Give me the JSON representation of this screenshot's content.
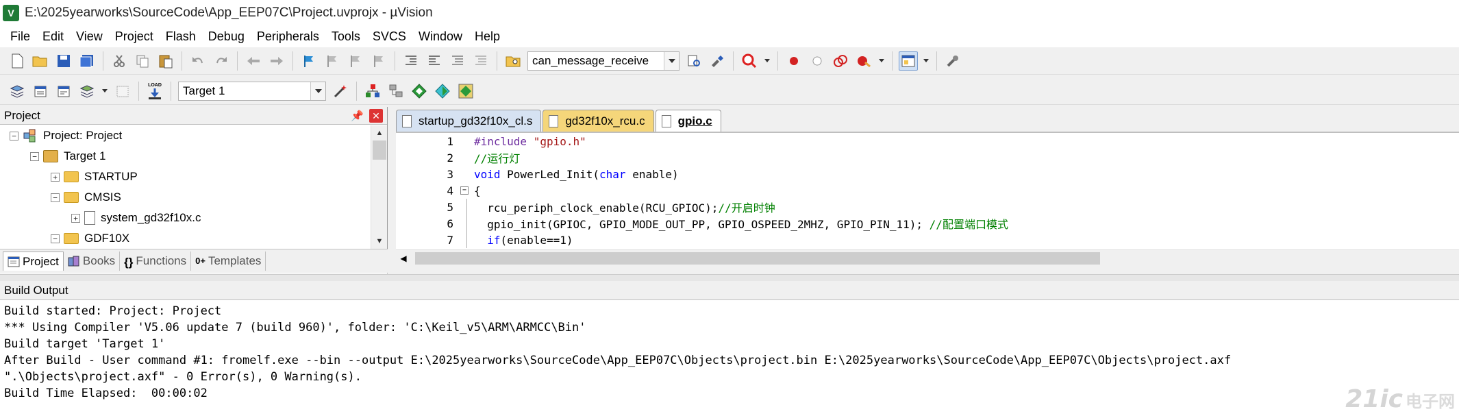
{
  "window": {
    "title": "E:\\2025yearworks\\SourceCode\\App_EEP07C\\Project.uvprojx - µVision",
    "app_icon": "V"
  },
  "menu": [
    "File",
    "Edit",
    "View",
    "Project",
    "Flash",
    "Debug",
    "Peripherals",
    "Tools",
    "SVCS",
    "Window",
    "Help"
  ],
  "toolbar1": {
    "find_combo_value": "can_message_receive"
  },
  "toolbar2": {
    "target_combo_value": "Target 1",
    "load_label": "LOAD"
  },
  "project_panel": {
    "title": "Project",
    "pin_glyph": "📌",
    "close_glyph": "✕",
    "tree": [
      {
        "label": "Project: Project",
        "toggle": "−"
      },
      {
        "label": "Target 1",
        "toggle": "−"
      },
      {
        "label": "STARTUP",
        "toggle": "+"
      },
      {
        "label": "CMSIS",
        "toggle": "−"
      },
      {
        "label": "system_gd32f10x.c",
        "toggle": "+"
      },
      {
        "label": "GDF10X",
        "toggle": "−"
      }
    ],
    "tabs": [
      "Project",
      "Books",
      "Functions",
      "Templates"
    ],
    "tab_glyphs": [
      "{}",
      "0+"
    ]
  },
  "editor": {
    "tabs": [
      "startup_gd32f10x_cl.s",
      "gd32f10x_rcu.c",
      "gpio.c"
    ],
    "lines": [
      {
        "n": "1",
        "parts": [
          [
            "pp",
            "#include "
          ],
          [
            "str",
            "\"gpio.h\""
          ]
        ]
      },
      {
        "n": "2",
        "parts": [
          [
            "cm",
            "//运行灯"
          ]
        ]
      },
      {
        "n": "3",
        "parts": [
          [
            "kw",
            "void"
          ],
          [
            "",
            " PowerLed_Init("
          ],
          [
            "kw",
            "char"
          ],
          [
            "",
            " enable)"
          ]
        ]
      },
      {
        "n": "4",
        "parts": [
          [
            "",
            "{"
          ]
        ]
      },
      {
        "n": "5",
        "parts": [
          [
            "",
            "  rcu_periph_clock_enable(RCU_GPIOC);"
          ],
          [
            "cm",
            "//开启时钟"
          ]
        ]
      },
      {
        "n": "6",
        "parts": [
          [
            "",
            "  gpio_init(GPIOC, GPIO_MODE_OUT_PP, GPIO_OSPEED_2MHZ, GPIO_PIN_11); "
          ],
          [
            "cm",
            "//配置端口模式"
          ]
        ]
      },
      {
        "n": "7",
        "parts": [
          [
            "",
            "  "
          ],
          [
            "kw",
            "if"
          ],
          [
            "",
            "(enable==1)"
          ]
        ]
      }
    ]
  },
  "build": {
    "title": "Build Output",
    "lines": [
      "Build started: Project: Project",
      "*** Using Compiler 'V5.06 update 7 (build 960)', folder: 'C:\\Keil_v5\\ARM\\ARMCC\\Bin'",
      "Build target 'Target 1'",
      "After Build - User command #1: fromelf.exe --bin --output E:\\2025yearworks\\SourceCode\\App_EEP07C\\Objects\\project.bin E:\\2025yearworks\\SourceCode\\App_EEP07C\\Objects\\project.axf",
      "\".\\Objects\\project.axf\" - 0 Error(s), 0 Warning(s).",
      "Build Time Elapsed:  00:00:02"
    ]
  },
  "watermark": {
    "logo": "21ic",
    "text": "电子网"
  }
}
